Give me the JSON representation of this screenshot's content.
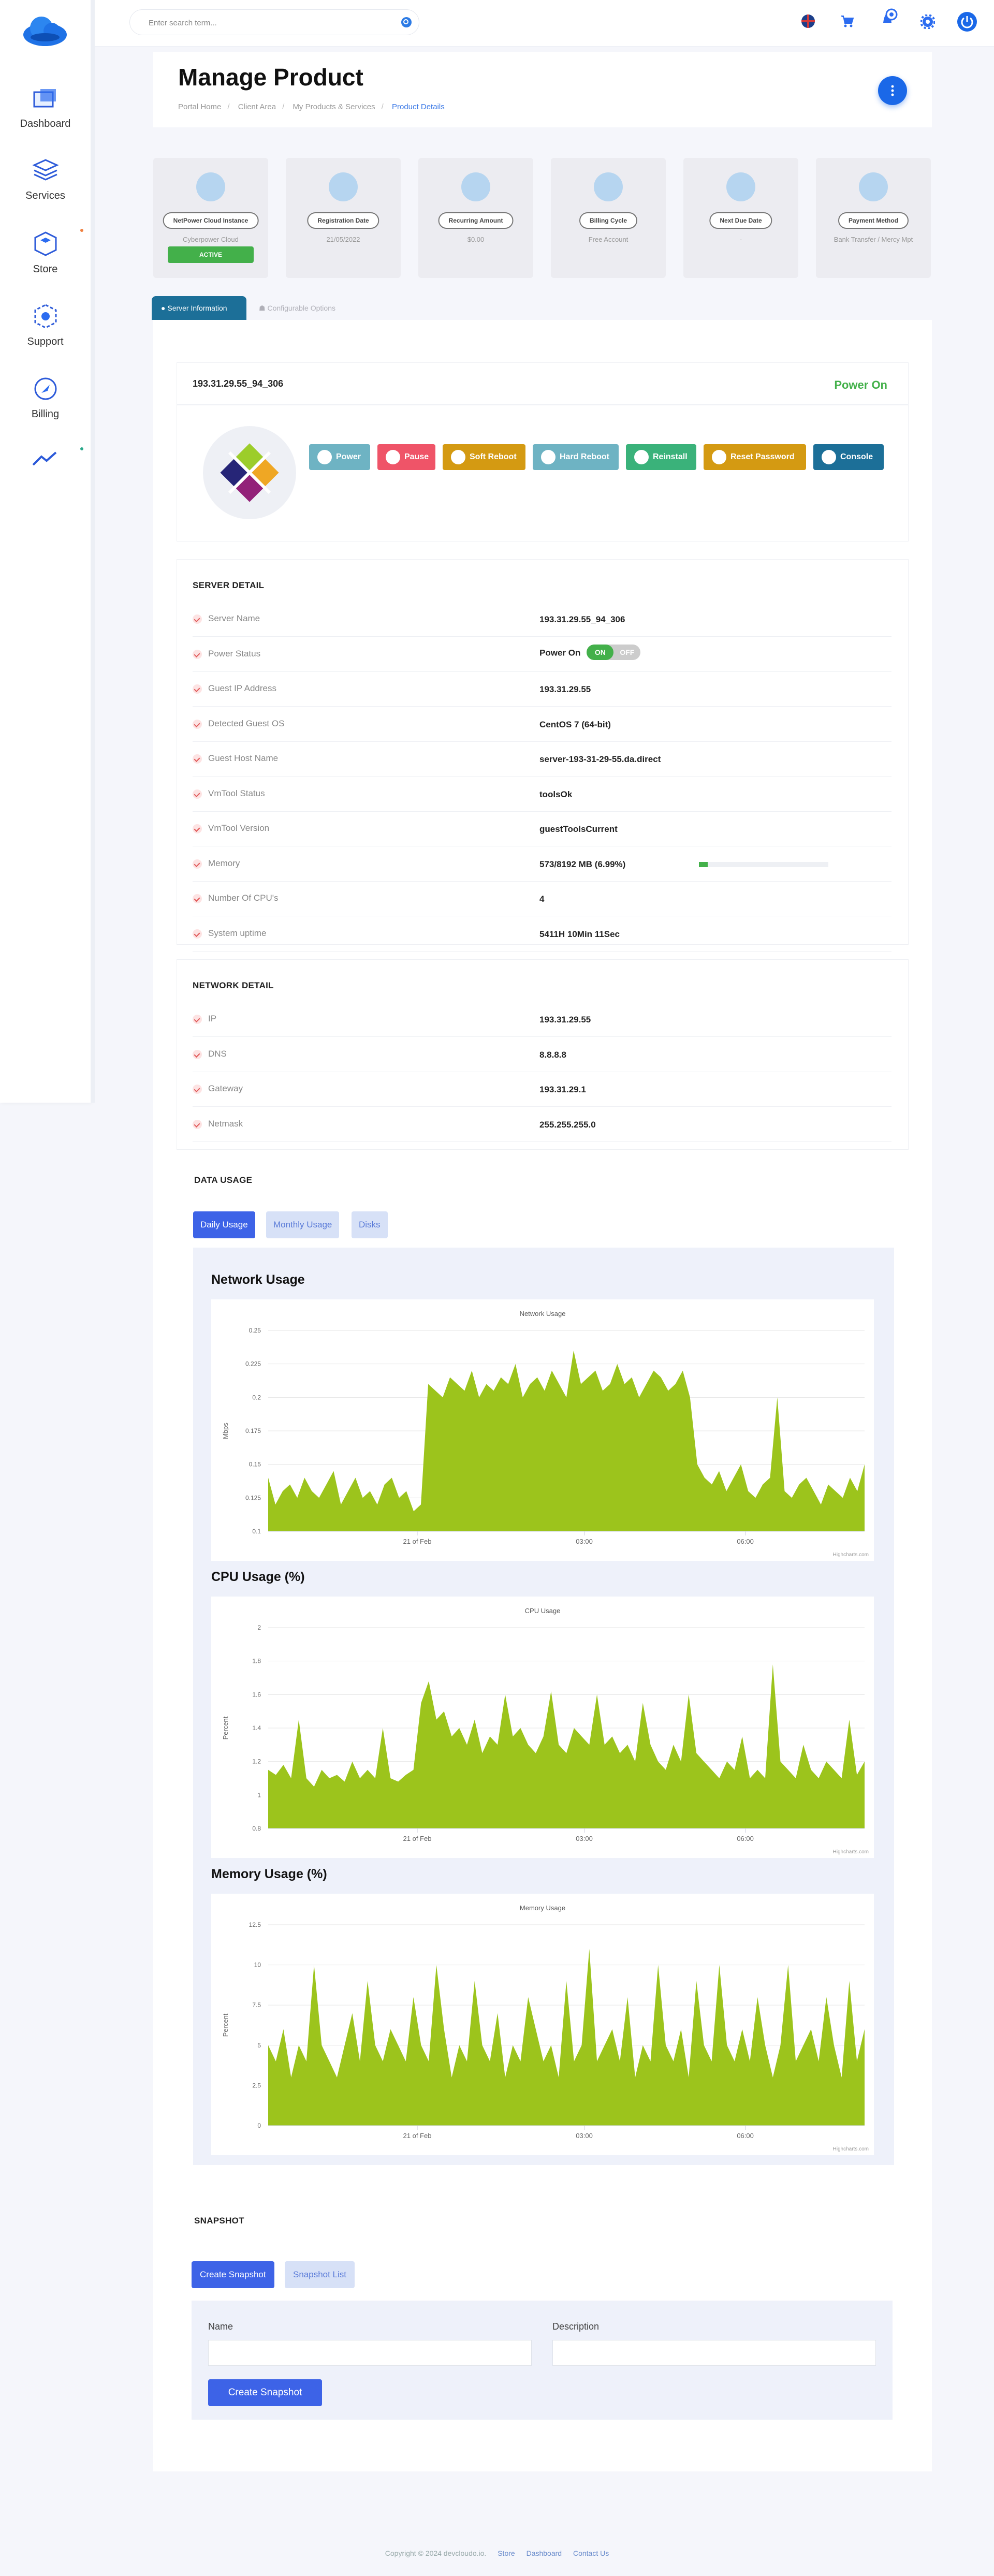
{
  "search": {
    "placeholder": "Enter search term..."
  },
  "sidebar": {
    "items": [
      {
        "label": "Dashboard"
      },
      {
        "label": "Services"
      },
      {
        "label": "Store"
      },
      {
        "label": "Support"
      },
      {
        "label": "Billing"
      }
    ]
  },
  "header": {
    "title": "Manage Product",
    "breadcrumbs": [
      "Portal Home",
      "Client Area",
      "My Products & Services",
      "Product Details"
    ]
  },
  "stats": [
    {
      "label": "NetPower Cloud Instance",
      "value": "Cyberpower Cloud",
      "badge": "ACTIVE"
    },
    {
      "label": "Registration Date",
      "value": "21/05/2022"
    },
    {
      "label": "Recurring Amount",
      "value": "$0.00"
    },
    {
      "label": "Billing Cycle",
      "value": "Free Account"
    },
    {
      "label": "Next Due Date",
      "value": "-"
    },
    {
      "label": "Payment Method",
      "value": "Bank Transfer / Mercy Mpt"
    }
  ],
  "tabs": {
    "server": "Server Information",
    "config": "Configurable Options"
  },
  "server": {
    "name": "193.31.29.55_94_306",
    "power": "Power On"
  },
  "actions": [
    {
      "label": "Power",
      "color": "#6eb3c3"
    },
    {
      "label": "Pause",
      "color": "#ef5468"
    },
    {
      "label": "Soft Reboot",
      "color": "#d49a12"
    },
    {
      "label": "Hard Reboot",
      "color": "#6eb3c3"
    },
    {
      "label": "Reinstall",
      "color": "#3ab27a"
    },
    {
      "label": "Reset Password",
      "color": "#d49a12"
    },
    {
      "label": "Console",
      "color": "#1c6f98"
    }
  ],
  "server_detail": {
    "title": "SERVER DETAIL",
    "rows": [
      {
        "label": "Server Name",
        "value": "193.31.29.55_94_306"
      },
      {
        "label": "Power Status",
        "value": "Power On",
        "toggle_on": "ON",
        "toggle_off": "OFF"
      },
      {
        "label": "Guest IP Address",
        "value": "193.31.29.55"
      },
      {
        "label": "Detected Guest OS",
        "value": "CentOS 7 (64-bit)"
      },
      {
        "label": "Guest Host Name",
        "value": "server-193-31-29-55.da.direct"
      },
      {
        "label": "VmTool Status",
        "value": "toolsOk"
      },
      {
        "label": "VmTool Version",
        "value": "guestToolsCurrent"
      },
      {
        "label": "Memory",
        "value": "573/8192 MB (6.99%)",
        "percent": 6.99
      },
      {
        "label": "Number Of CPU's",
        "value": "4"
      },
      {
        "label": "System uptime",
        "value": "5411H 10Min 11Sec"
      }
    ]
  },
  "network_detail": {
    "title": "NETWORK DETAIL",
    "rows": [
      {
        "label": "IP",
        "value": "193.31.29.55"
      },
      {
        "label": "DNS",
        "value": "8.8.8.8"
      },
      {
        "label": "Gateway",
        "value": "193.31.29.1"
      },
      {
        "label": "Netmask",
        "value": "255.255.255.0"
      }
    ]
  },
  "data_usage": {
    "title": "DATA USAGE",
    "tabs": [
      "Daily Usage",
      "Monthly Usage",
      "Disks"
    ]
  },
  "colors": {
    "accent": "#3d63e7",
    "series": "#9cc41c",
    "success": "#43b04a"
  },
  "chart_data": [
    {
      "type": "area",
      "heading": "Network Usage",
      "title": "Network Usage",
      "ylabel": "Mbps",
      "ylim": [
        0.1,
        0.25
      ],
      "yticks": [
        0.1,
        0.125,
        0.15,
        0.175,
        0.2,
        0.225,
        0.25
      ],
      "xticks": [
        "21 of Feb",
        "03:00",
        "06:00"
      ],
      "credit": "Highcharts.com",
      "series": [
        {
          "values": [
            0.14,
            0.12,
            0.13,
            0.135,
            0.125,
            0.14,
            0.13,
            0.125,
            0.135,
            0.145,
            0.12,
            0.13,
            0.14,
            0.125,
            0.13,
            0.12,
            0.135,
            0.14,
            0.125,
            0.13,
            0.115,
            0.12,
            0.21,
            0.205,
            0.2,
            0.215,
            0.21,
            0.205,
            0.22,
            0.2,
            0.21,
            0.205,
            0.215,
            0.21,
            0.225,
            0.2,
            0.21,
            0.215,
            0.205,
            0.22,
            0.21,
            0.2,
            0.235,
            0.21,
            0.215,
            0.22,
            0.205,
            0.21,
            0.225,
            0.21,
            0.215,
            0.2,
            0.21,
            0.22,
            0.215,
            0.205,
            0.21,
            0.22,
            0.2,
            0.15,
            0.14,
            0.135,
            0.145,
            0.13,
            0.14,
            0.15,
            0.13,
            0.125,
            0.135,
            0.14,
            0.2,
            0.13,
            0.125,
            0.135,
            0.14,
            0.13,
            0.12,
            0.135,
            0.13,
            0.125,
            0.14,
            0.13,
            0.15
          ]
        }
      ]
    },
    {
      "type": "area",
      "heading": "CPU Usage (%)",
      "title": "CPU Usage",
      "ylabel": "Percent",
      "ylim": [
        0.8,
        2
      ],
      "yticks": [
        0.8,
        1,
        1.2,
        1.4,
        1.6,
        1.8,
        2
      ],
      "xticks": [
        "21 of Feb",
        "03:00",
        "06:00"
      ],
      "credit": "Highcharts.com",
      "series": [
        {
          "values": [
            1.15,
            1.12,
            1.18,
            1.1,
            1.45,
            1.1,
            1.05,
            1.15,
            1.1,
            1.12,
            1.08,
            1.2,
            1.1,
            1.15,
            1.1,
            1.4,
            1.1,
            1.08,
            1.12,
            1.15,
            1.55,
            1.68,
            1.45,
            1.5,
            1.35,
            1.4,
            1.3,
            1.45,
            1.25,
            1.35,
            1.3,
            1.6,
            1.35,
            1.4,
            1.3,
            1.25,
            1.35,
            1.62,
            1.3,
            1.25,
            1.4,
            1.35,
            1.3,
            1.6,
            1.3,
            1.35,
            1.25,
            1.3,
            1.2,
            1.55,
            1.3,
            1.2,
            1.15,
            1.3,
            1.2,
            1.6,
            1.25,
            1.2,
            1.15,
            1.1,
            1.2,
            1.15,
            1.35,
            1.1,
            1.15,
            1.1,
            1.78,
            1.2,
            1.15,
            1.1,
            1.3,
            1.15,
            1.1,
            1.2,
            1.15,
            1.1,
            1.45,
            1.12,
            1.2
          ]
        }
      ]
    },
    {
      "type": "area",
      "heading": "Memory Usage (%)",
      "title": "Memory Usage",
      "ylabel": "Percent",
      "ylim": [
        0,
        12.5
      ],
      "yticks": [
        0,
        2.5,
        5,
        7.5,
        10,
        12.5
      ],
      "xticks": [
        "21 of Feb",
        "03:00",
        "06:00"
      ],
      "credit": "Highcharts.com",
      "series": [
        {
          "values": [
            5,
            4,
            6,
            3,
            5,
            4,
            10,
            5,
            4,
            3,
            5,
            7,
            4,
            9,
            5,
            4,
            6,
            5,
            4,
            8,
            5,
            4,
            10,
            6,
            3,
            5,
            4,
            9,
            5,
            4,
            7,
            3,
            5,
            4,
            8,
            6,
            4,
            5,
            3,
            9,
            4,
            5,
            11,
            4,
            5,
            6,
            4,
            8,
            3,
            5,
            4,
            10,
            5,
            4,
            6,
            3,
            9,
            5,
            4,
            10,
            5,
            4,
            6,
            4,
            8,
            5,
            3,
            5,
            10,
            4,
            5,
            6,
            4,
            8,
            5,
            3,
            9,
            4,
            6
          ]
        }
      ]
    }
  ],
  "snapshot": {
    "title": "SNAPSHOT",
    "create_tab": "Create Snapshot",
    "list_tab": "Snapshot List",
    "name_label": "Name",
    "desc_label": "Description",
    "button": "Create Snapshot"
  },
  "footer": {
    "copy": "Copyright © 2024 devcloudo.io.",
    "links": [
      "Store",
      "Dashboard",
      "Contact Us"
    ]
  }
}
